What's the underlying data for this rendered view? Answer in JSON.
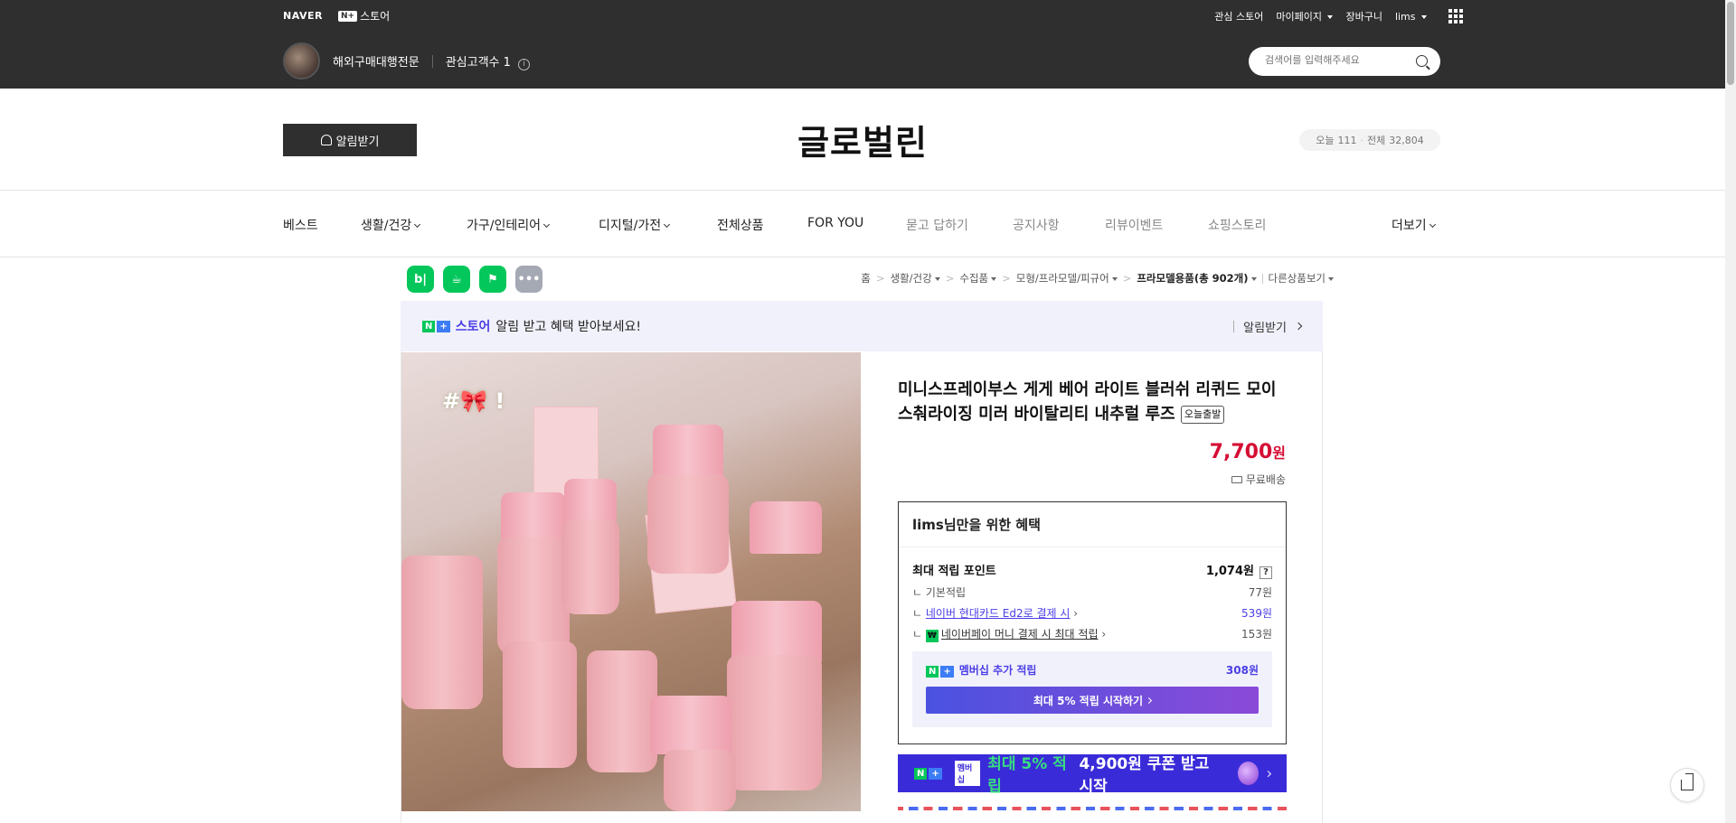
{
  "topbar": {
    "naver": "NAVER",
    "nplus_badge": "N+",
    "nplus_label": "스토어",
    "links": [
      "관심 스토어",
      "마이페이지",
      "장바구니",
      "lims"
    ],
    "store_name": "해외구매대행전문",
    "interest_label": "관심고객수",
    "interest_count": "1",
    "search_placeholder": "검색어를 입력해주세요"
  },
  "header": {
    "alarm_label": "알림받기",
    "store_title": "글로벌린",
    "today_label": "오늘",
    "today_count": "111",
    "total_label": "전체",
    "total_count": "32,804"
  },
  "nav": {
    "items": [
      "베스트",
      "생활/건강",
      "가구/인테리어",
      "디지털/가전",
      "전체상품",
      "FOR YOU",
      "묻고 답하기",
      "공지사항",
      "리뷰이벤트",
      "쇼핑스토리"
    ],
    "more": "더보기"
  },
  "share_buttons": [
    "bl",
    "cafe",
    "bookmark",
    "more"
  ],
  "breadcrumb": {
    "home": "홈",
    "c1": "생활/건강",
    "c2": "수집품",
    "c3": "모형/프라모델/피규어",
    "c4": "프라모델용품",
    "c4_count": "(총 902개)",
    "other": "다른상품보기"
  },
  "promo": {
    "store": "스토어",
    "text": "알림 받고 혜택 받아보세요!",
    "action": "알림받기"
  },
  "product": {
    "image_tag": "#🎀 !",
    "title": "미니스프레이부스 게게 베어 라이트 블러쉬 리퀴드 모이스춰라이징 미러 바이탈리티 내추럴 루즈",
    "today_badge": "오늘출발",
    "price": "7,700",
    "price_unit": "원",
    "shipping": "무료배송"
  },
  "benefit": {
    "title": "lims님만을 위한 혜택",
    "max_point_label": "최대 적립 포인트",
    "max_point_value": "1,074원",
    "rows": [
      {
        "label": "기본적립",
        "value": "77원"
      },
      {
        "label": "네이버 현대카드 Ed2로 결제 시",
        "value": "539원"
      },
      {
        "label": "네이버페이 머니 결제 시 최대 적립",
        "value": "153원"
      }
    ],
    "member_label": "멤버십 추가 적립",
    "member_value": "308원",
    "member_button": "최대 5% 적립 시작하기"
  },
  "coupon": {
    "badge": "멤버십",
    "green_text": "최대 5% 적립",
    "white_text": "4,900원 쿠폰 받고 시작"
  },
  "colors": {
    "topbar": "#2f2f2f",
    "price": "#d50f35",
    "accent": "#4b3ee6",
    "naver_green": "#03c75a"
  }
}
